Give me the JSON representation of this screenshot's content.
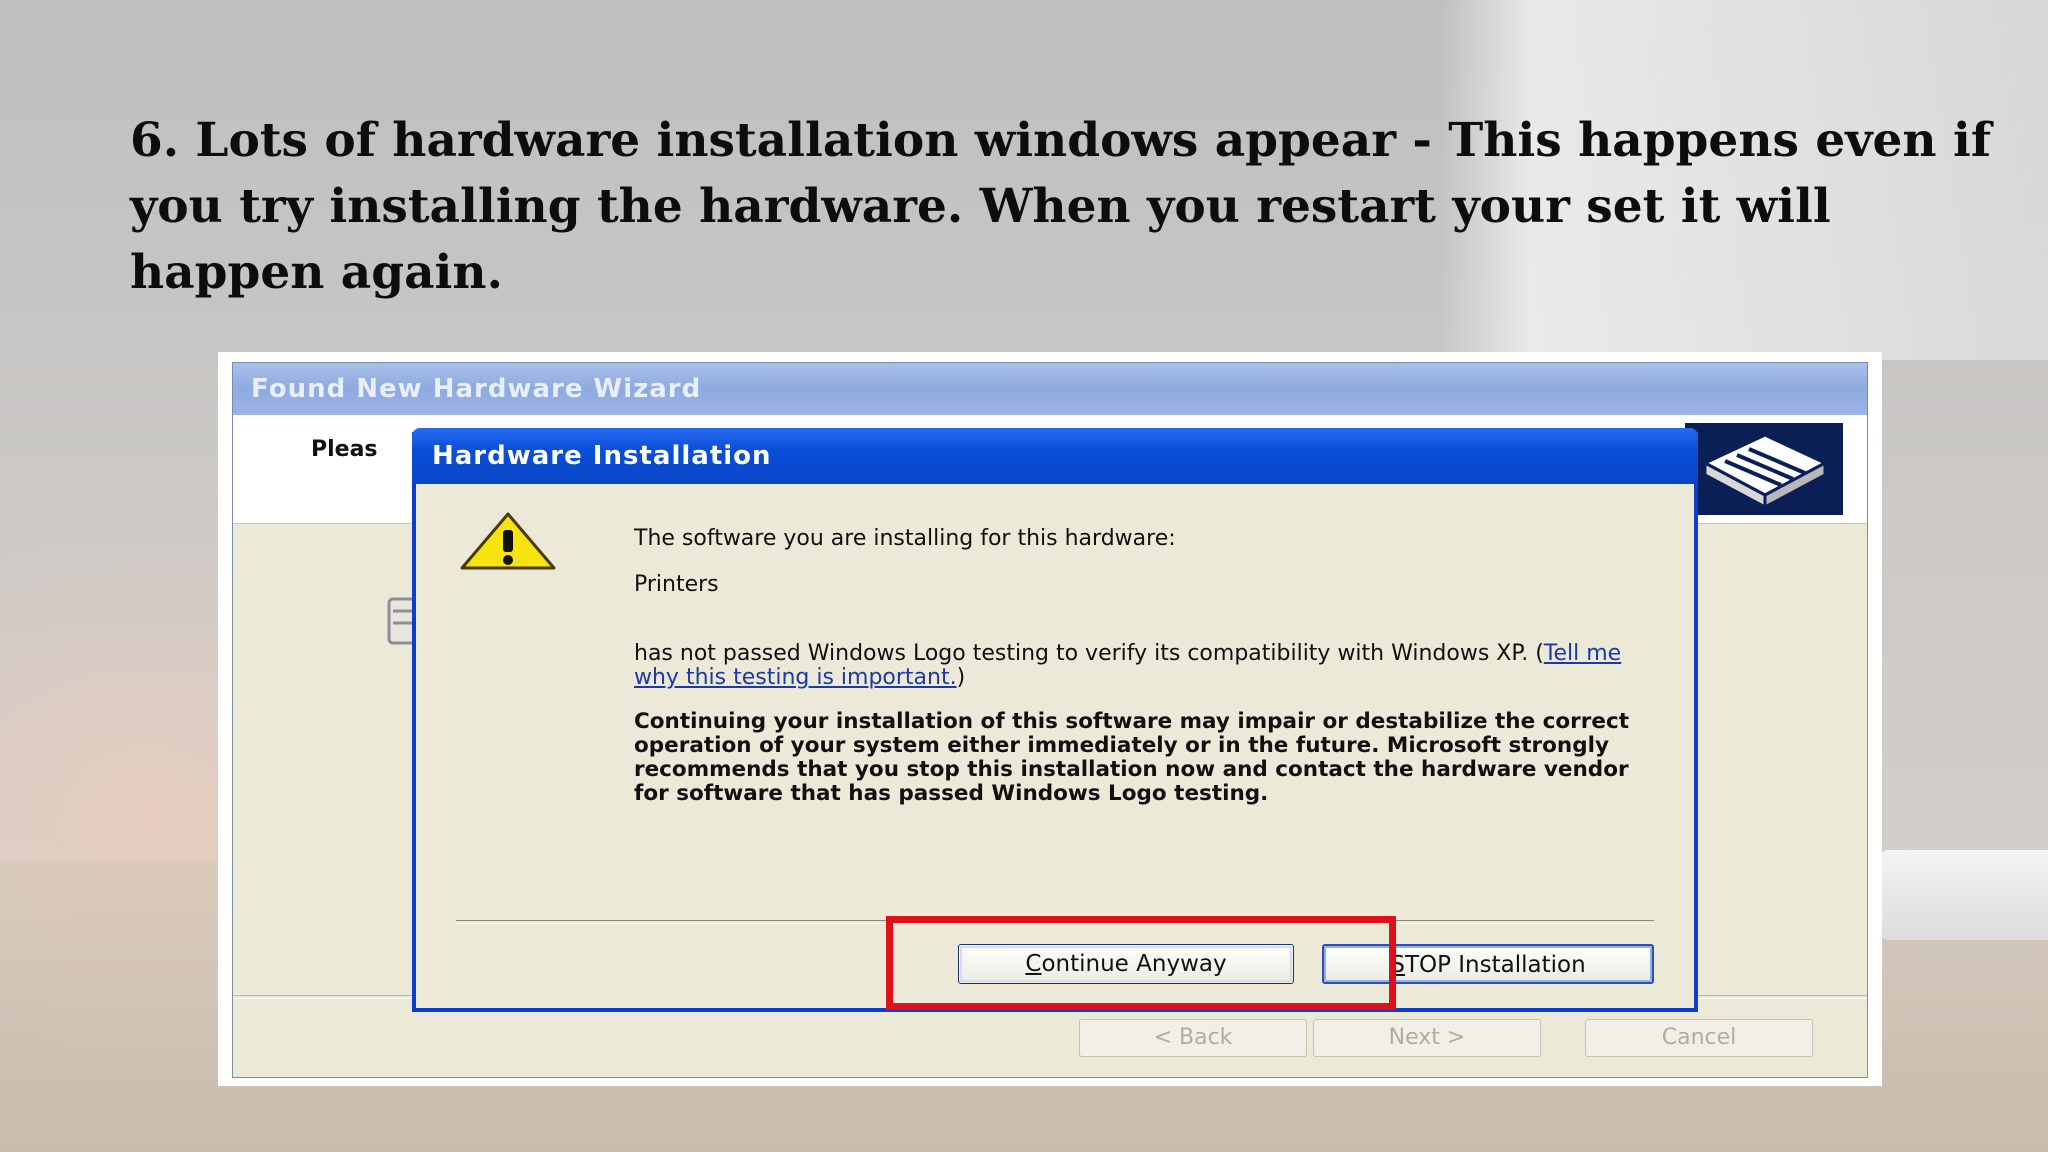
{
  "slide": {
    "heading_lines": [
      "6. Lots of hardware installation windows appear - This happens even if",
      "you try installing the hardware. When you restart your set it will",
      "happen again."
    ]
  },
  "wizard": {
    "title": "Found New Hardware Wizard",
    "header_text": "Pleas",
    "buttons": {
      "back": "< Back",
      "next": "Next >",
      "cancel": "Cancel"
    }
  },
  "dialog": {
    "title": "Hardware Installation",
    "line1": "The software you are installing for this hardware:",
    "device": "Printers",
    "line3_a": "has not passed Windows Logo testing to verify its compatibility with Windows XP. (",
    "link": "Tell me why this testing is important.",
    "line3_b": ")",
    "warning": "Continuing your installation of this software may impair or destabilize the correct operation of your system either immediately or in the future. Microsoft strongly recommends that you stop this installation now and contact the hardware vendor for software that has passed Windows Logo testing.",
    "buttons": {
      "continue_mnemonic": "C",
      "continue_rest": "ontinue Anyway",
      "stop_mnemonic": "S",
      "stop_rest": "TOP Installation"
    }
  },
  "colors": {
    "highlight": "#e0101b",
    "dialog_title": "#0a4ed8",
    "link": "#1a3aa8"
  }
}
